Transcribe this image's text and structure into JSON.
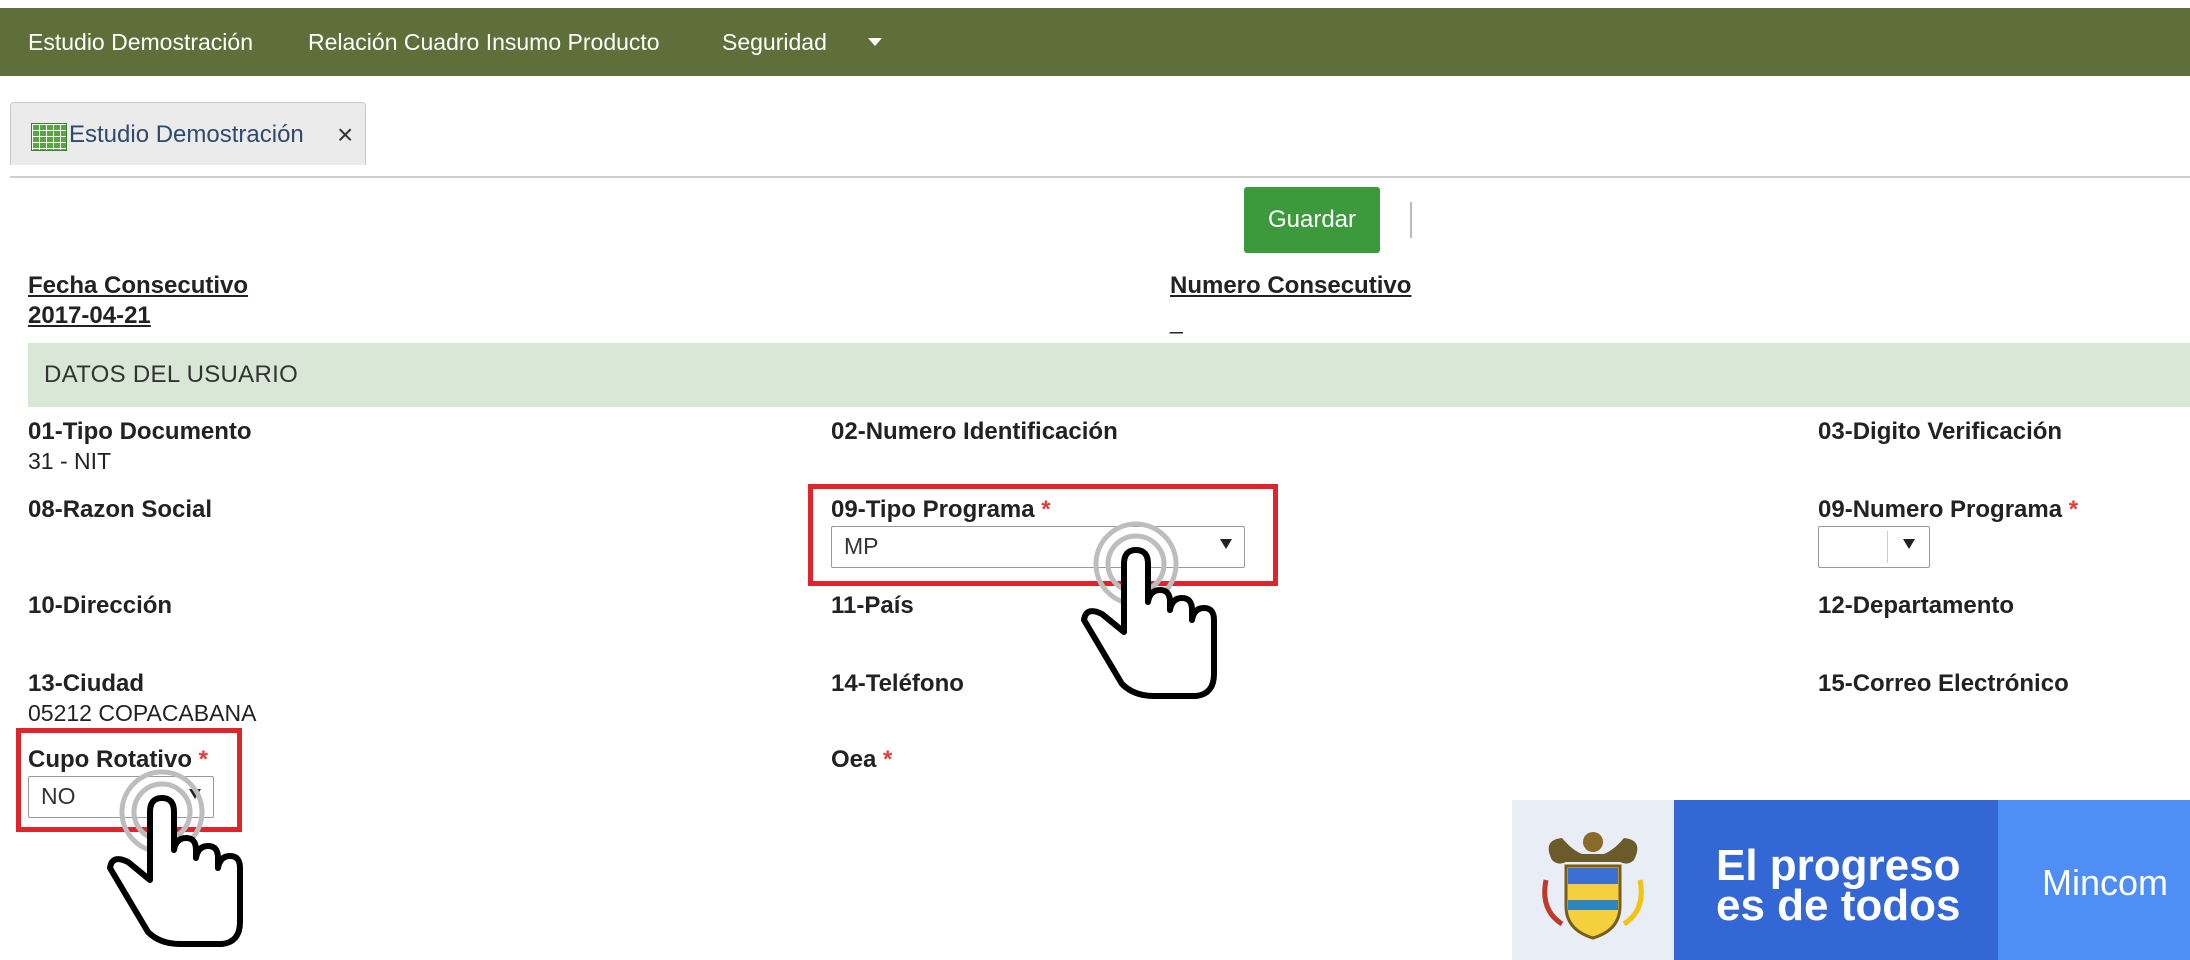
{
  "nav": {
    "items": [
      "Estudio Demostración",
      "Relación Cuadro Insumo Producto",
      "Seguridad"
    ]
  },
  "tab": {
    "label": "Estudio Demostración",
    "close": "×"
  },
  "toolbar": {
    "save_label": "Guardar"
  },
  "header": {
    "fecha_label": "Fecha Consecutivo",
    "fecha_value": "2017-04-21",
    "numero_label": "Numero Consecutivo",
    "numero_value": "_"
  },
  "section_title": "DATOS DEL USUARIO",
  "fields": {
    "f01_label": "01-Tipo Documento",
    "f01_value": "31 - NIT",
    "f02_label": "02-Numero Identificación",
    "f03_label": "03-Digito Verificación",
    "f08_label": "08-Razon Social",
    "f09_label": "09-Tipo Programa",
    "f09_value": "MP",
    "f09n_label": "09-Numero Programa",
    "f10_label": "10-Dirección",
    "f11_label": "11-País",
    "f12_label": "12-Departamento",
    "f13_label": "13-Ciudad",
    "f13_value": "05212 COPACABANA",
    "f14_label": "14-Teléfono",
    "f15_label": "15-Correo Electrónico",
    "cupo_label": "Cupo Rotativo",
    "cupo_value": "NO",
    "oea_label": "Oea",
    "required_mark": "*"
  },
  "footer": {
    "slogan": "El progreso\nes de todos",
    "brand": "Mincom"
  },
  "colors": {
    "nav_bg": "#5e6f3a",
    "save_bg": "#3c9a3c",
    "section_bg": "#d9e8d6",
    "highlight": "#e0242b"
  },
  "icons": [
    "grid-icon",
    "close-icon",
    "chevron-down-icon",
    "hand-pointer-icon",
    "coat-of-arms-icon"
  ]
}
